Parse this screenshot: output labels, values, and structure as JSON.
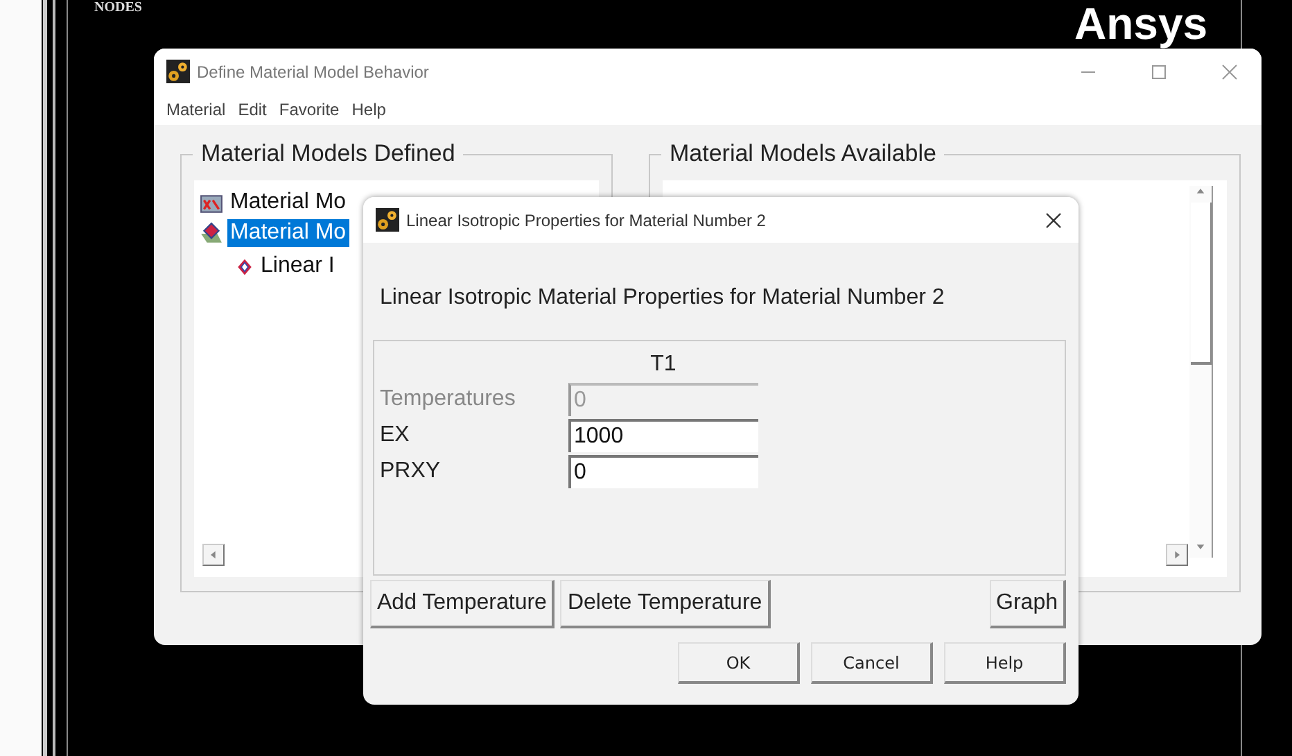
{
  "background": {
    "label": "NODES",
    "brand": "Ansys"
  },
  "main_window": {
    "title": "Define Material Model Behavior",
    "menu": [
      "Material",
      "Edit",
      "Favorite",
      "Help"
    ],
    "defined": {
      "title": "Material Models Defined",
      "tree": [
        {
          "label": "Material Mo",
          "selected": false,
          "kind": "table"
        },
        {
          "label": "Material Mo",
          "selected": true,
          "kind": "folder",
          "children": [
            {
              "label": "Linear I",
              "selected": false,
              "kind": "model"
            }
          ]
        }
      ]
    },
    "available": {
      "title": "Material Models Available"
    }
  },
  "dialog": {
    "title": "Linear Isotropic Properties for Material Number 2",
    "heading": "Linear Isotropic Material Properties for Material Number 2",
    "column": "T1",
    "rows": [
      {
        "label": "Temperatures",
        "value": "0",
        "disabled": true
      },
      {
        "label": "EX",
        "value": "1000",
        "disabled": false
      },
      {
        "label": "PRXY",
        "value": "0",
        "disabled": false
      }
    ],
    "actions": [
      "Add Temperature",
      "Delete Temperature"
    ],
    "graph_button": "Graph",
    "buttons": [
      "OK",
      "Cancel",
      "Help"
    ]
  }
}
